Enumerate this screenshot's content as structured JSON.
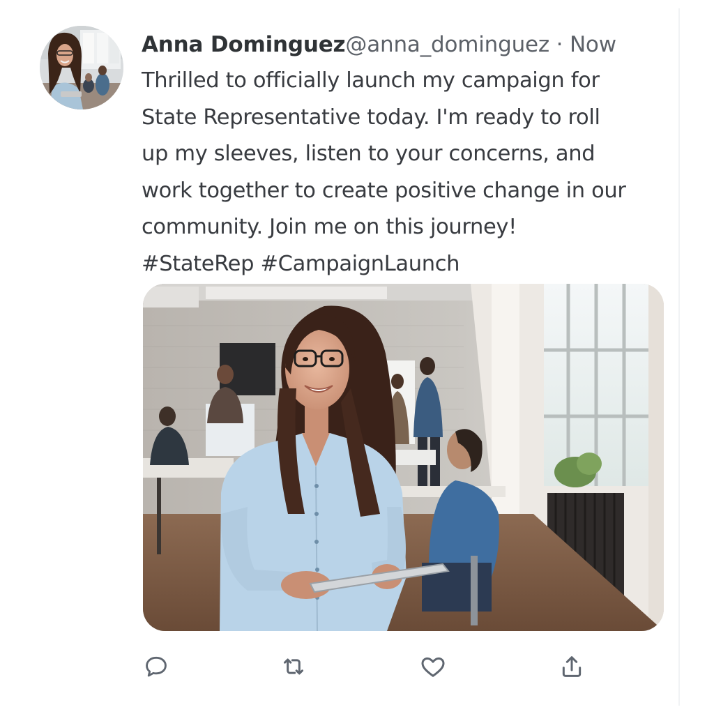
{
  "tweet": {
    "author": {
      "display_name": "Anna Dominguez",
      "handle": "@anna_dominguez"
    },
    "separator": " · ",
    "timestamp": "Now",
    "body_lines": [
      "Thrilled to officially launch my campaign for",
      "State Representative today. I'm ready to roll",
      "up my sleeves, listen to your concerns, and",
      "work together to create positive change in our",
      "community. Join me on this journey!"
    ],
    "hashtags": [
      "#StateRep",
      "#CampaignLaunch"
    ]
  },
  "actions": {
    "icons": [
      "reply-icon",
      "retweet-icon",
      "like-icon",
      "share-icon"
    ]
  },
  "colors": {
    "text": "#383b40",
    "secondary_text": "#5c6168",
    "icon": "#5f6670"
  }
}
